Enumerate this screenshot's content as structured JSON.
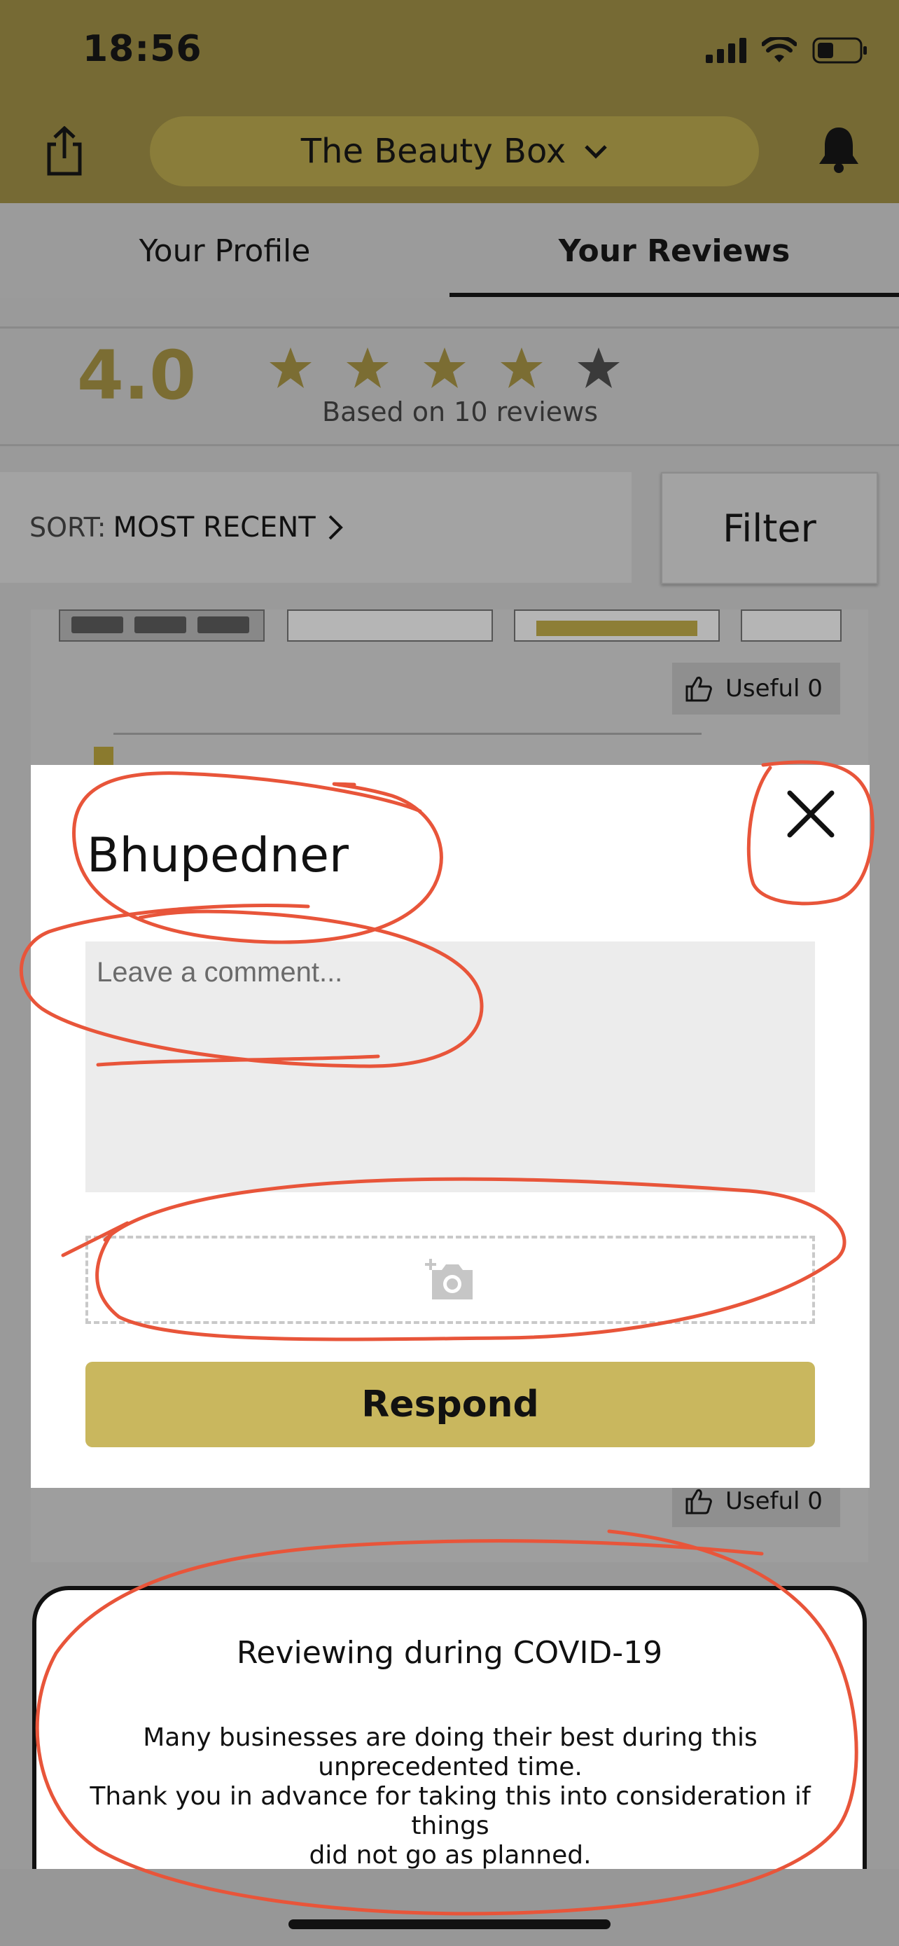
{
  "status_bar": {
    "time": "18:56"
  },
  "header": {
    "business_name": "The Beauty Box"
  },
  "tabs": [
    {
      "label": "Your Profile",
      "active": false
    },
    {
      "label": "Your Reviews",
      "active": true
    }
  ],
  "rating": {
    "value": "4.0",
    "stars_filled": 4,
    "stars_total": 5,
    "basis": "Based on 10 reviews"
  },
  "sort": {
    "label": "SORT:",
    "value": "MOST RECENT"
  },
  "filter_label": "Filter",
  "background_review": {
    "useful_top": "Useful 0",
    "useful_bottom": "Useful 0"
  },
  "modal": {
    "name": "Bhupedner",
    "comment_placeholder": "Leave a comment...",
    "respond_label": "Respond"
  },
  "covid_banner": {
    "title": "Reviewing during COVID-19",
    "line1": "Many businesses are doing their best during this",
    "line2": "unprecedented time.",
    "line3": "Thank you in advance for taking this into consideration if things",
    "line4": "did not go as planned."
  },
  "colors": {
    "header": "#766a34",
    "accent_gold": "#c9b75e",
    "annotation_red": "#e8553a"
  },
  "icons": [
    "share-icon",
    "chevron-down-icon",
    "bell-icon",
    "star-icon",
    "chevron-right-icon",
    "thumbs-up-icon",
    "close-icon",
    "camera-add-icon",
    "signal-icon",
    "wifi-icon",
    "battery-icon"
  ]
}
